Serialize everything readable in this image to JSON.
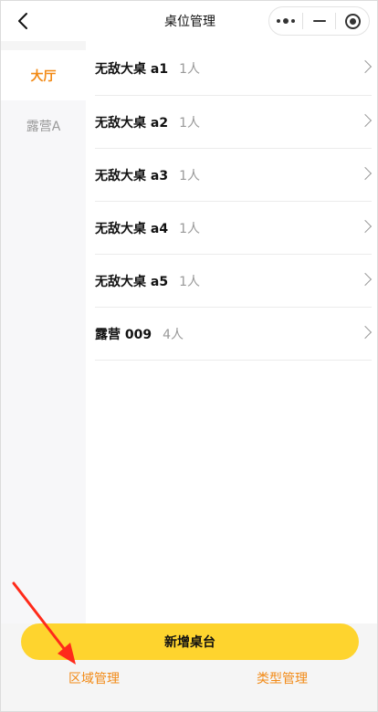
{
  "header": {
    "title": "桌位管理"
  },
  "sidebar": {
    "items": [
      {
        "label": "大厅",
        "active": true
      },
      {
        "label": "露营A",
        "active": false
      }
    ]
  },
  "tables": [
    {
      "name": "无敌大桌 a1",
      "count": "1人"
    },
    {
      "name": "无敌大桌 a2",
      "count": "1人"
    },
    {
      "name": "无敌大桌 a3",
      "count": "1人"
    },
    {
      "name": "无敌大桌 a4",
      "count": "1人"
    },
    {
      "name": "无敌大桌 a5",
      "count": "1人"
    },
    {
      "name": "露营 009",
      "count": "4人"
    }
  ],
  "bottom": {
    "add_label": "新增桌台",
    "area_manage_label": "区域管理",
    "type_manage_label": "类型管理"
  },
  "colors": {
    "accent_orange": "#f28a16",
    "button_yellow": "#fed42e",
    "annotation_red": "#ff2a1a"
  },
  "icons": {
    "back": "back-chevron-icon",
    "more": "more-dots-icon",
    "minimize": "minimize-icon",
    "close": "target-close-icon",
    "row_chevron": "chevron-right-icon"
  }
}
